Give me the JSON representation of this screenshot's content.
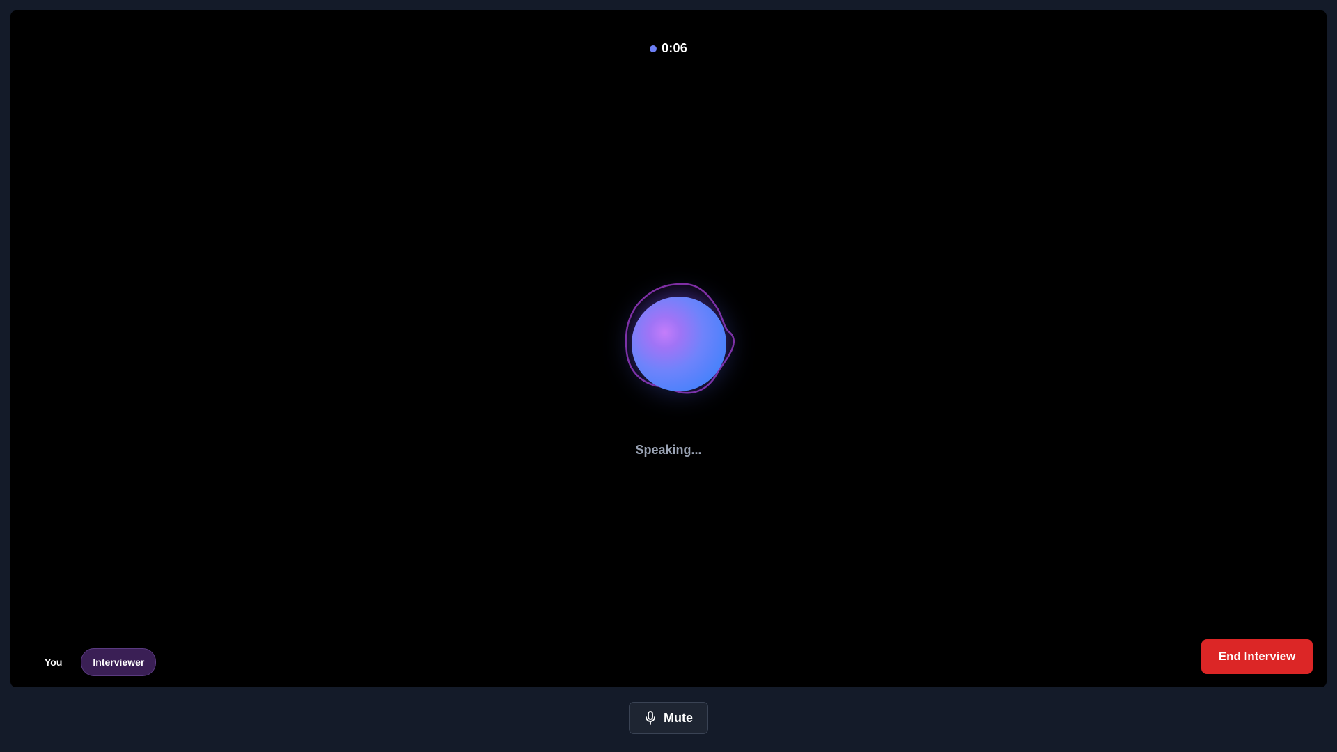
{
  "timer": {
    "text": "0:06",
    "dot_color": "#6d7ff5"
  },
  "orb": {
    "icon": "ai-voice-orb",
    "status_text": "Speaking..."
  },
  "participants": [
    {
      "label": "You",
      "active": false
    },
    {
      "label": "Interviewer",
      "active": true
    }
  ],
  "controls": {
    "end_label": "End Interview",
    "end_color": "#dc2626",
    "mute_label": "Mute",
    "mute_icon": "microphone-icon"
  }
}
